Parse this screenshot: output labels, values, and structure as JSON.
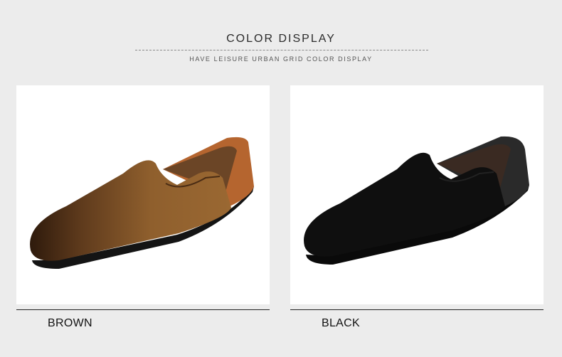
{
  "header": {
    "title": "COLOR DISPLAY",
    "subtitle": "HAVE LEISURE URBAN GRID COLOR DISPLAY"
  },
  "variants": [
    {
      "label": "BROWN",
      "colors": {
        "upper": "#8b5a2b",
        "toe": "#3a2312",
        "heel": "#b5652f",
        "sole": "#1a1a1a",
        "lining": "#6b4526"
      }
    },
    {
      "label": "BLACK",
      "colors": {
        "upper": "#111111",
        "toe": "#050505",
        "heel": "#2a2a2a",
        "sole": "#0c0c0c",
        "lining": "#3a2a22"
      }
    }
  ]
}
